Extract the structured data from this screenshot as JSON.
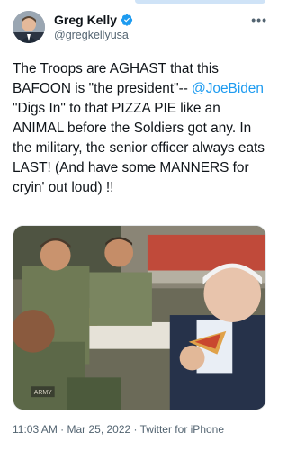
{
  "tweet": {
    "author": {
      "display_name": "Greg Kelly",
      "handle": "@gregkellyusa",
      "verified": true,
      "avatar_icon": "person-avatar"
    },
    "more_icon": "more-horizontal-icon",
    "text_parts": [
      {
        "type": "text",
        "value": "The Troops are AGHAST that this BAFOON is \"the president\"-- "
      },
      {
        "type": "mention",
        "value": "@JoeBiden"
      },
      {
        "type": "text",
        "value": " \"Digs In\" to that PIZZA PIE like an ANIMAL before the Soldiers got any. In the military, the senior officer always eats LAST! (And have some MANNERS for cryin' out loud) !!"
      }
    ],
    "media": {
      "patch_text": "ARMY"
    },
    "timestamp": "11:03 AM · Mar 25, 2022 · Twitter for iPhone",
    "colors": {
      "link": "#1d9bf0",
      "text": "#0f1419",
      "secondary": "#536471"
    }
  }
}
